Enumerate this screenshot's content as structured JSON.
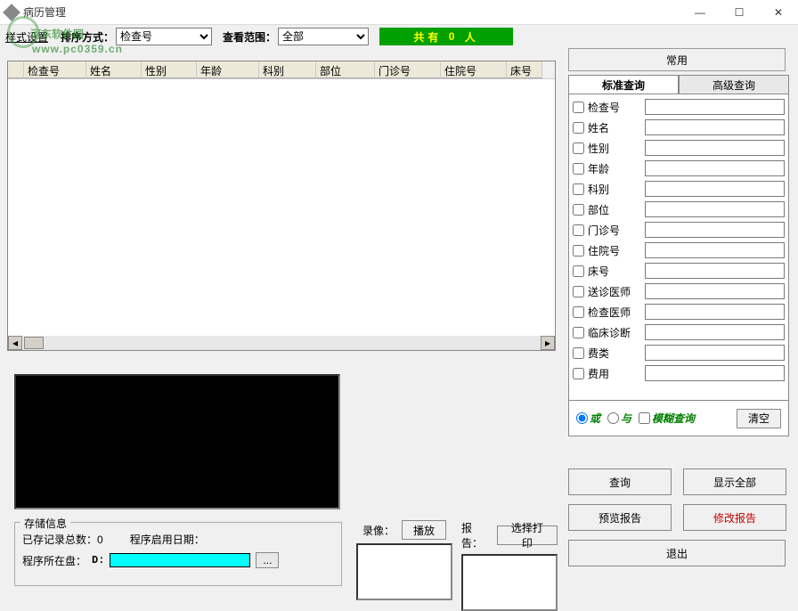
{
  "window": {
    "title": "病历管理",
    "min": "—",
    "max": "☐",
    "close": "✕"
  },
  "watermark": {
    "main": "河东软件园",
    "sub": "www.pc0359.cn"
  },
  "toolbar": {
    "style_label": "样式设置",
    "sort_label": "排序方式：",
    "sort_value": "检查号",
    "range_label": "查看范围：",
    "range_value": "全部",
    "count_prefix": "共有",
    "count_num": "0",
    "count_suffix": "人"
  },
  "columns": [
    "检查号",
    "姓名",
    "性别",
    "年龄",
    "科别",
    "部位",
    "门诊号",
    "住院号",
    "床号"
  ],
  "storage": {
    "group": "存储信息",
    "line1_label": "已存记录总数：",
    "line1_value": "0",
    "line1b_label": "程序启用日期：",
    "line1b_value": "",
    "line2_label": "程序所在盘：",
    "disk": "D:",
    "dots": "..."
  },
  "rec": {
    "video_label": "录像：",
    "play": "播放",
    "report_label": "报告：",
    "choose_print": "选择打印"
  },
  "right": {
    "common": "常用",
    "tab_std": "标准查询",
    "tab_adv": "高级查询",
    "fields": [
      "检查号",
      "姓名",
      "性别",
      "年龄",
      "科别",
      "部位",
      "门诊号",
      "住院号",
      "床号",
      "送诊医师",
      "检查医师",
      "临床诊断",
      "费类",
      "费用"
    ],
    "opt_or": "或",
    "opt_and": "与",
    "opt_fuzzy": "模糊查询",
    "clear": "清空",
    "query": "查询",
    "show_all": "显示全部",
    "preview": "预览报告",
    "modify": "修改报告",
    "exit": "退出"
  }
}
